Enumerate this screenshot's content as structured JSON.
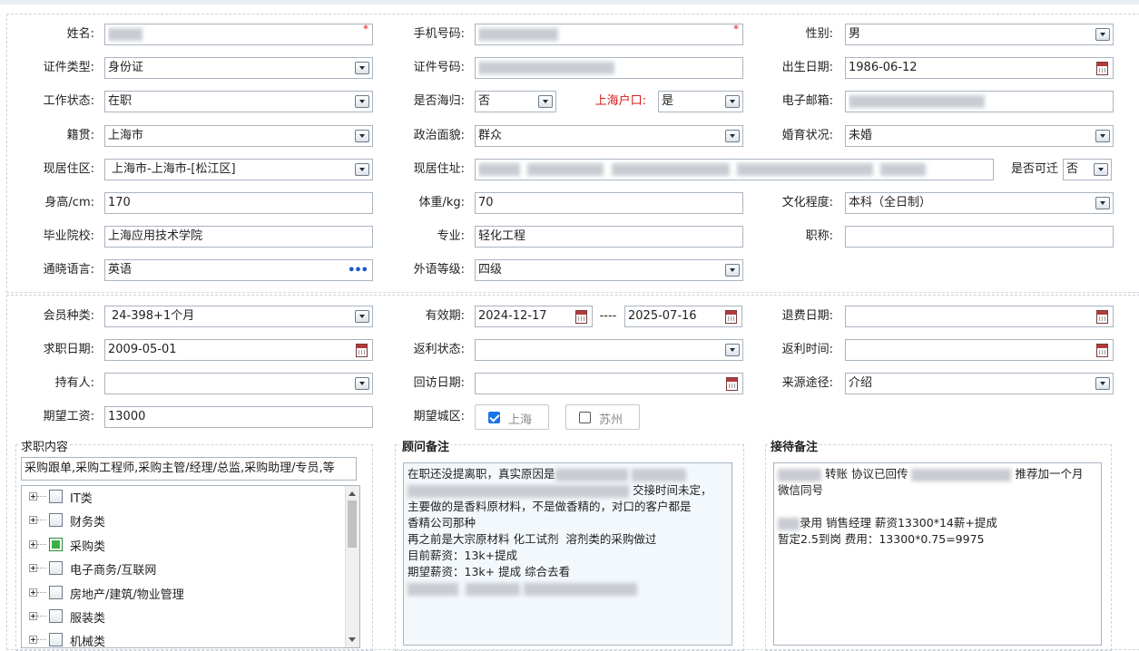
{
  "form": {
    "name": {
      "label": "姓名:",
      "required_mark": "*"
    },
    "phone": {
      "label": "手机号码:",
      "required_mark": "*"
    },
    "gender": {
      "label": "性别:",
      "value": "男"
    },
    "id_type": {
      "label": "证件类型:",
      "value": "身份证"
    },
    "id_number": {
      "label": "证件号码:"
    },
    "birth_date": {
      "label": "出生日期:",
      "value": "1986-06-12"
    },
    "work_status": {
      "label": "工作状态:",
      "value": "在职"
    },
    "returnee": {
      "label": "是否海归:",
      "value": "否"
    },
    "shanghai_hukou": {
      "label": "上海户口:",
      "value": "是"
    },
    "email": {
      "label": "电子邮箱:"
    },
    "native_place": {
      "label": "籍贯:",
      "value": "上海市"
    },
    "political_status": {
      "label": "政治面貌:",
      "value": "群众"
    },
    "marital_status": {
      "label": "婚育状况:",
      "value": "未婚"
    },
    "residence_area": {
      "label": "现居住区:",
      "value": "上海市-上海市-[松江区]"
    },
    "residence_address": {
      "label": "现居住址:"
    },
    "relocatable": {
      "label": "是否可迁",
      "value": "否"
    },
    "height": {
      "label": "身高/cm:",
      "value": "170"
    },
    "weight": {
      "label": "体重/kg:",
      "value": "70"
    },
    "education": {
      "label": "文化程度:",
      "value": "本科（全日制）"
    },
    "school": {
      "label": "毕业院校:",
      "value": "上海应用技术学院"
    },
    "major": {
      "label": "专业:",
      "value": "轻化工程"
    },
    "title": {
      "label": "职称:",
      "value": ""
    },
    "language": {
      "label": "通晓语言:",
      "value": "英语"
    },
    "language_level": {
      "label": "外语等级:",
      "value": "四级"
    }
  },
  "member": {
    "type": {
      "label": "会员种类:",
      "value": "24-398+1个月"
    },
    "validity": {
      "label": "有效期:",
      "start": "2024-12-17",
      "separator": "----",
      "end": "2025-07-16"
    },
    "refund_date": {
      "label": "退费日期:",
      "value": ""
    },
    "job_date": {
      "label": "求职日期:",
      "value": "2009-05-01"
    },
    "rebate_status": {
      "label": "返利状态:",
      "value": ""
    },
    "rebate_time": {
      "label": "返利时间:",
      "value": ""
    },
    "holder": {
      "label": "持有人:",
      "value": ""
    },
    "revisit_date": {
      "label": "回访日期:",
      "value": ""
    },
    "source": {
      "label": "来源途径:",
      "value": "介绍"
    },
    "salary": {
      "label": "期望工资:",
      "value": "13000"
    },
    "city": {
      "label": "期望城区:",
      "options": [
        {
          "name": "上海",
          "checked": true
        },
        {
          "name": "苏州",
          "checked": false
        }
      ]
    }
  },
  "job_content": {
    "title": "求职内容",
    "selected": "采购跟单,采购工程师,采购主管/经理/总监,采购助理/专员,等",
    "tree": [
      {
        "label": "IT类",
        "checked": false
      },
      {
        "label": "财务类",
        "checked": false
      },
      {
        "label": "采购类",
        "checked": true
      },
      {
        "label": "电子商务/互联网",
        "checked": false
      },
      {
        "label": "房地产/建筑/物业管理",
        "checked": false
      },
      {
        "label": "服装类",
        "checked": false
      },
      {
        "label": "机械类",
        "checked": false
      }
    ]
  },
  "advisor_notes": {
    "title": "顾问备注",
    "line1": "在职还没提离职，真实原因是",
    "line2_tail": "交接时间未定，",
    "line3": "主要做的是香料原材料，不是做香精的，对口的客户都是",
    "line4": "香精公司那种",
    "line5": "再之前是大宗原材料 化工试剂  溶剂类的采购做过",
    "line6": "目前薪资：13k+提成",
    "line7": "期望薪资：13k+ 提成 综合去看"
  },
  "reception_notes": {
    "title": "接待备注",
    "line1_mid": "转账 协议已回传",
    "line1_tail": "推荐加一个月",
    "line2": "微信同号",
    "line3_tail": "录用 销售经理 薪资13300*14薪+提成",
    "line4": "暂定2.5到岗 费用：13300*0.75=9975"
  }
}
